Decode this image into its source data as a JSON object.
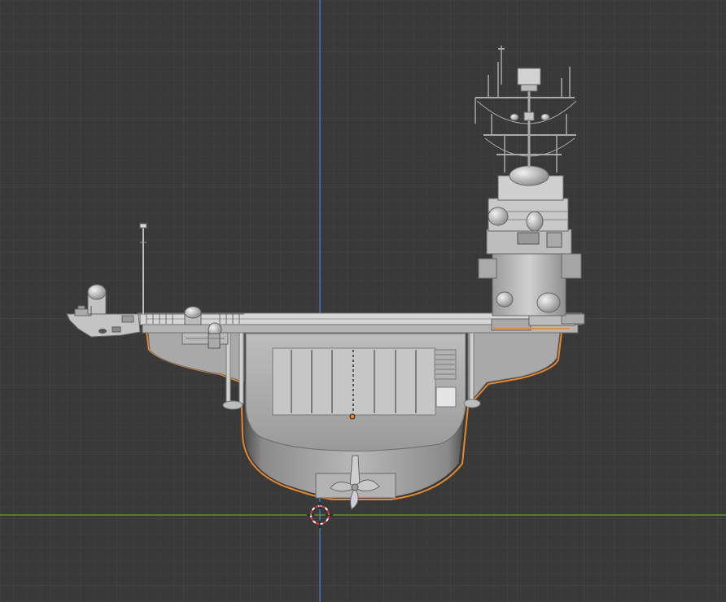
{
  "viewport": {
    "view": "back-orthographic",
    "background_color": "#393939",
    "grid_minor_color": "#414141",
    "grid_major_color": "#4a4a4a",
    "z_axis_color": "#3f7fc4",
    "y_axis_color": "#6f9a34",
    "selection_outline_color": "#e8862a"
  },
  "scene": {
    "object": "aircraft-carrier-model",
    "selected": true,
    "cursor": "3d-cursor-icon",
    "origin": "object-origin-dot"
  }
}
